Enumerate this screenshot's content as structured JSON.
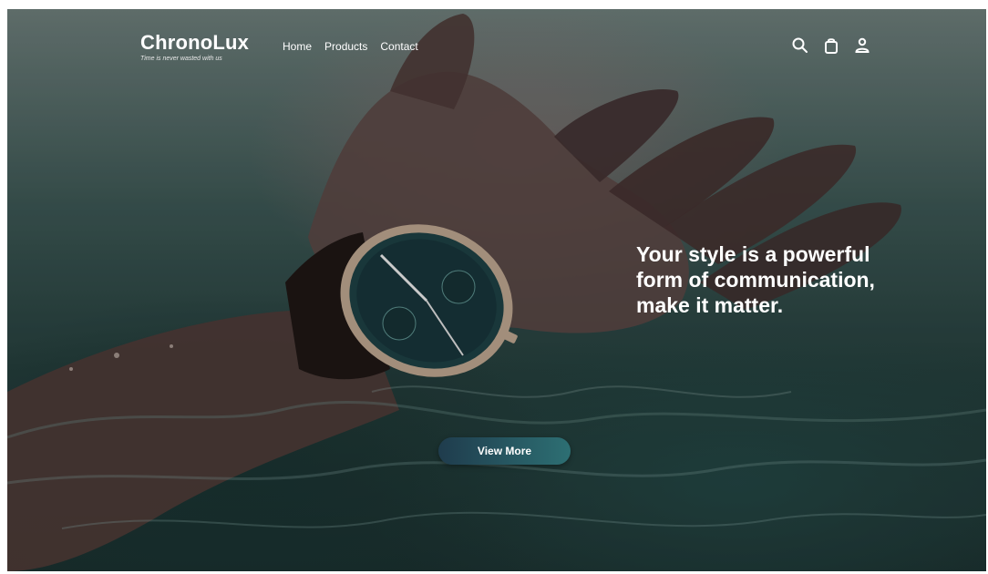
{
  "brand": {
    "name": "ChronoLux",
    "tagline": "Time is never wasted with us"
  },
  "nav": {
    "items": [
      "Home",
      "Products",
      "Contact"
    ]
  },
  "header_icons": [
    "search-icon",
    "shopping-bag-icon",
    "user-icon"
  ],
  "hero": {
    "headline": "Your style is a powerful form of communication, make it matter.",
    "cta_label": "View More"
  },
  "colors": {
    "text": "#ffffff",
    "button_gradient_start": "#1f3c4d",
    "button_gradient_end": "#2d6f73",
    "water_dark": "#1b2f2e"
  }
}
